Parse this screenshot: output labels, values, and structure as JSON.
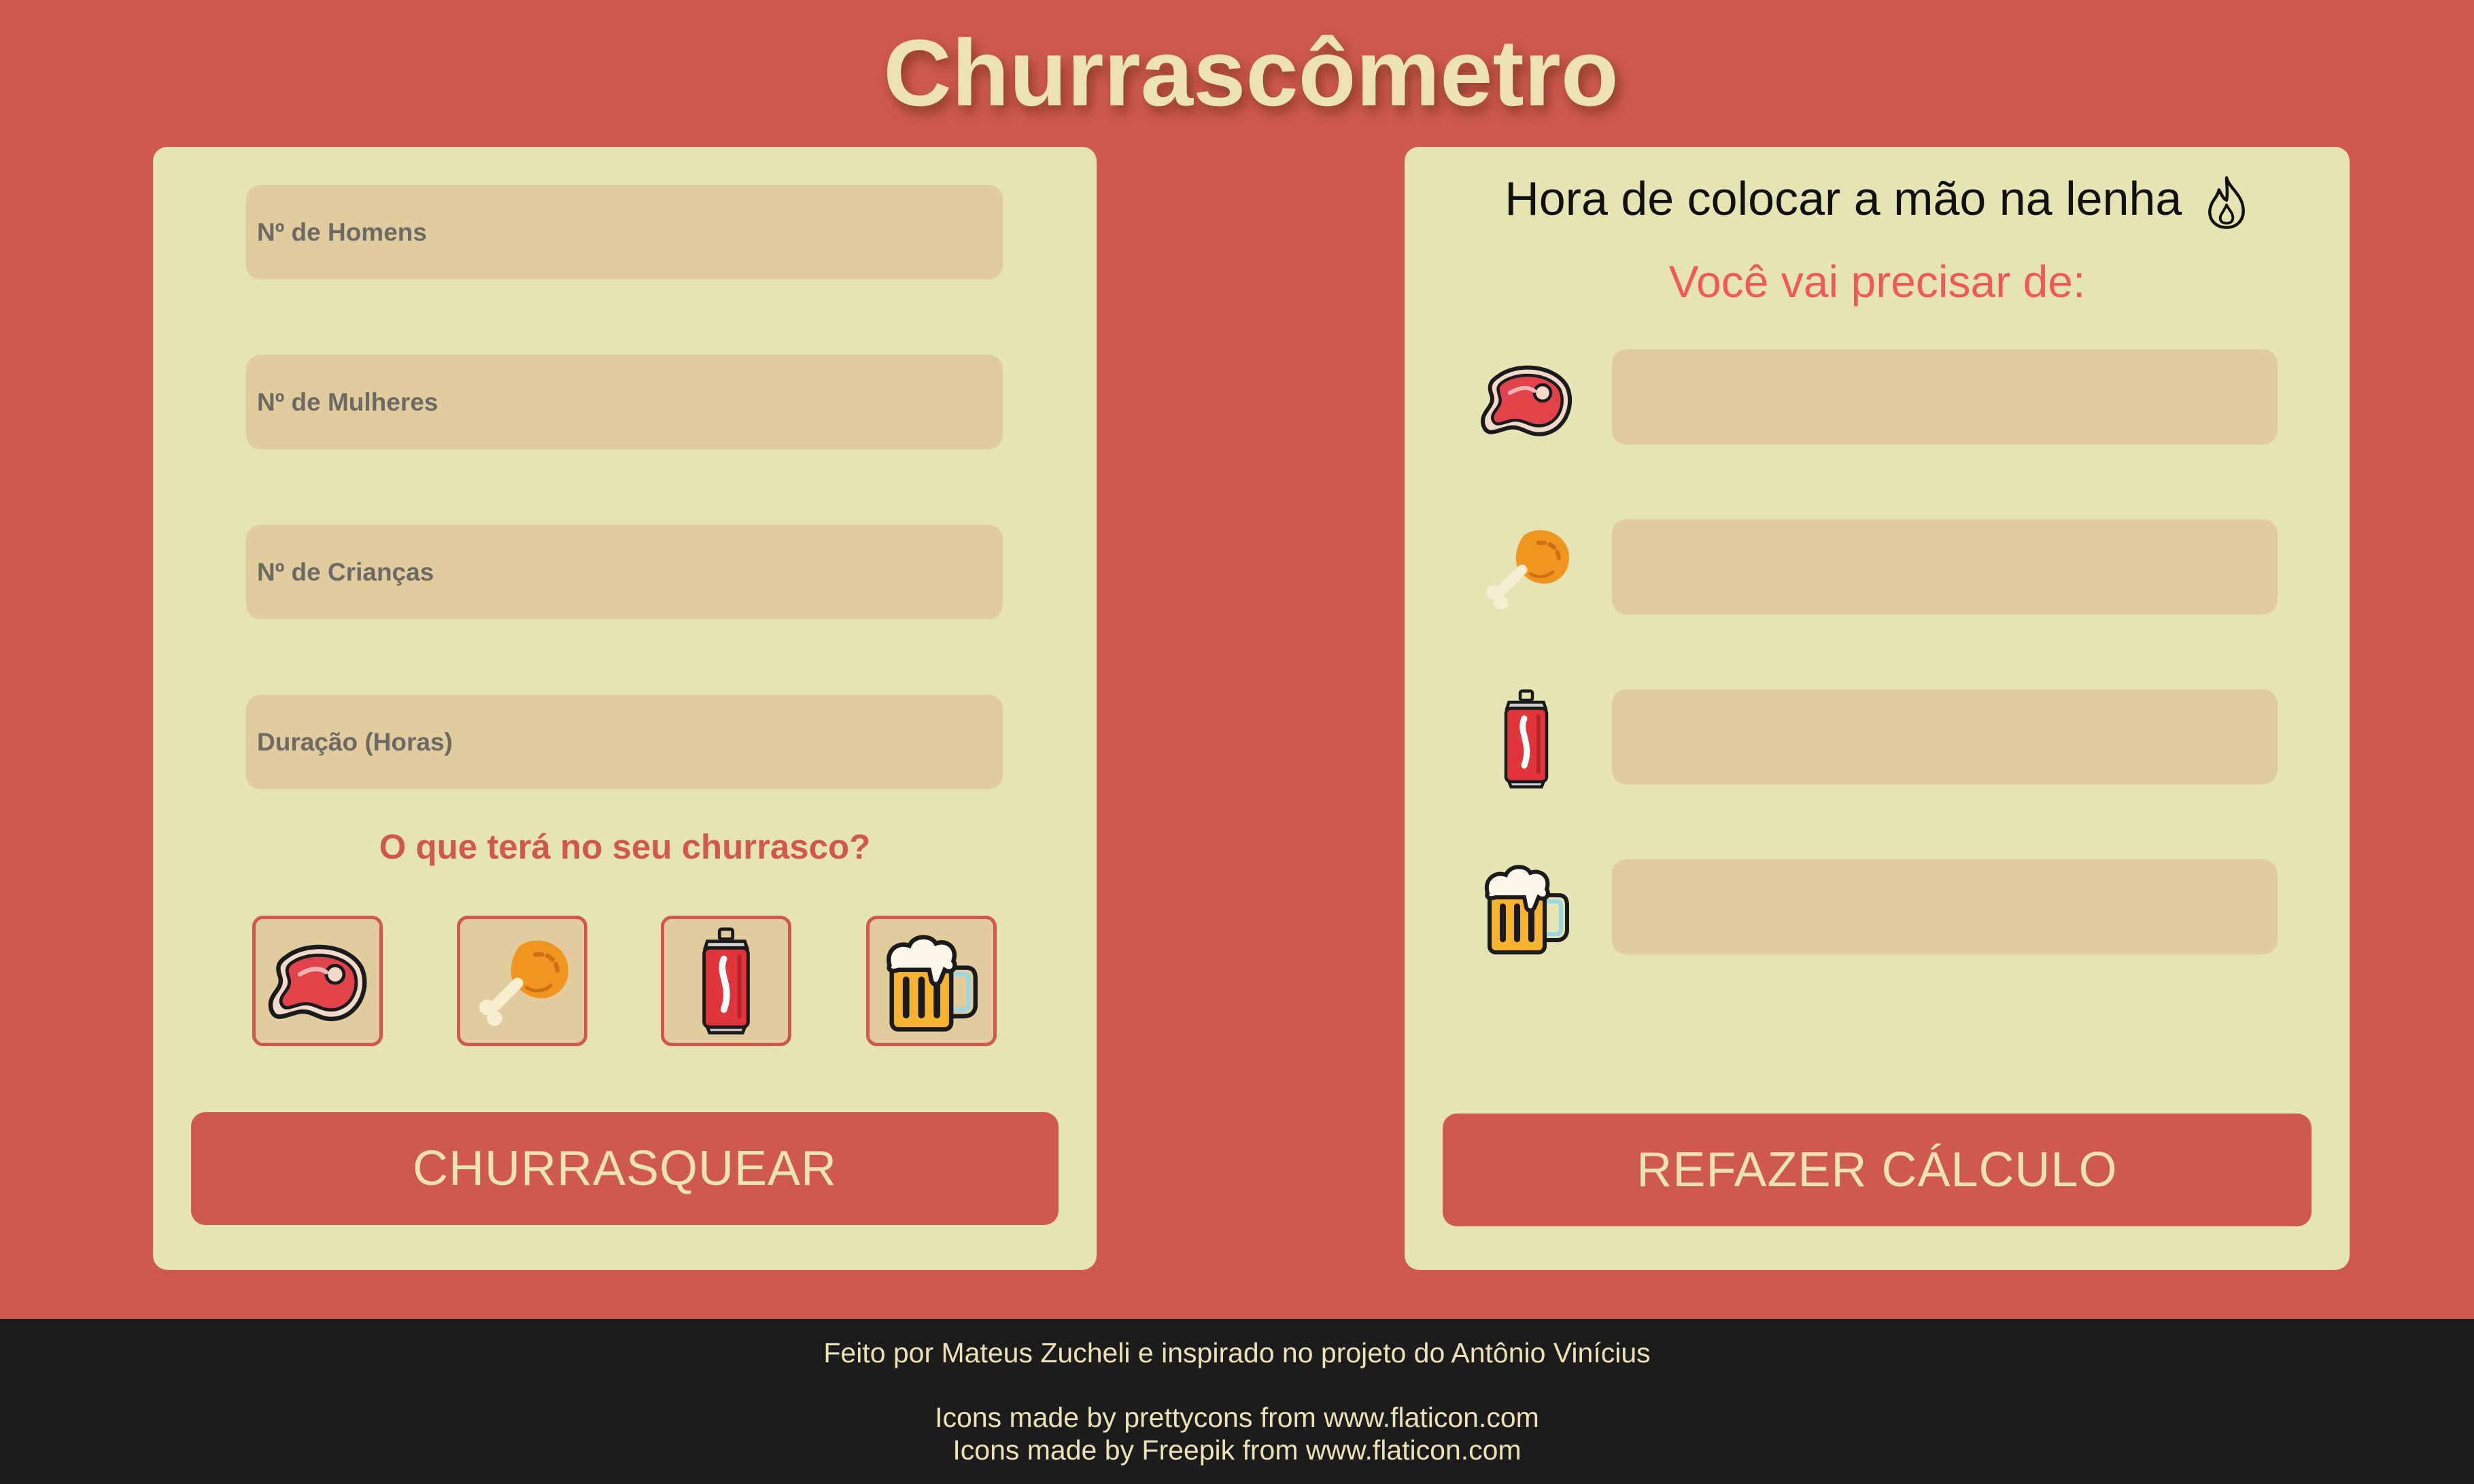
{
  "app": {
    "title": "Churrascômetro"
  },
  "form": {
    "men_placeholder": "Nº de Homens",
    "women_placeholder": "Nº de Mulheres",
    "children_placeholder": "Nº de Crianças",
    "duration_placeholder": "Duração (Horas)",
    "men_value": "",
    "women_value": "",
    "children_value": "",
    "duration_value": "",
    "question": "O que terá no seu churrasco?",
    "options": [
      {
        "icon": "steak-icon"
      },
      {
        "icon": "chicken-leg-icon"
      },
      {
        "icon": "soda-can-icon"
      },
      {
        "icon": "beer-mug-icon"
      }
    ],
    "submit_label": "CHURRASQUEAR"
  },
  "results": {
    "heading": "Hora de colocar a mão na lenha",
    "heading_icon": "fire-icon",
    "subheading": "Você vai precisar de:",
    "rows": [
      {
        "icon": "steak-icon",
        "value": ""
      },
      {
        "icon": "chicken-leg-icon",
        "value": ""
      },
      {
        "icon": "soda-can-icon",
        "value": ""
      },
      {
        "icon": "beer-mug-icon",
        "value": ""
      }
    ],
    "redo_label": "REFAZER CÁLCULO"
  },
  "footer": {
    "credit": "Feito por Mateus Zucheli e inspirado no projeto do Antônio Vinícius",
    "icons_credit_1": "Icons made by prettycons from www.flaticon.com",
    "icons_credit_2": "Icons made by Freepik from www.flaticon.com"
  },
  "colors": {
    "background": "#cf5a4b",
    "card": "#e7e4b3",
    "field": "#e2cb9d",
    "accent_text": "#ee5a5a",
    "cream": "#ece2b6",
    "footer": "#1c1c1c"
  }
}
